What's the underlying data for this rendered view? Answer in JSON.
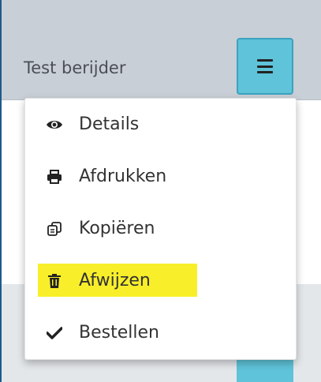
{
  "row": {
    "title": "Test berijder"
  },
  "menu": {
    "items": [
      {
        "label": "Details",
        "icon": "eye-icon"
      },
      {
        "label": "Afdrukken",
        "icon": "printer-icon"
      },
      {
        "label": "Kopiëren",
        "icon": "copy-icon"
      },
      {
        "label": "Afwijzen",
        "icon": "trash-icon",
        "highlighted": true
      },
      {
        "label": "Bestellen",
        "icon": "checkmark-icon"
      }
    ]
  },
  "colors": {
    "header_bg": "#c9cfd6",
    "toggle_accent": "#5fc3d9",
    "highlight": "#f8ef2a",
    "lower_band": "#e4e7ea"
  }
}
